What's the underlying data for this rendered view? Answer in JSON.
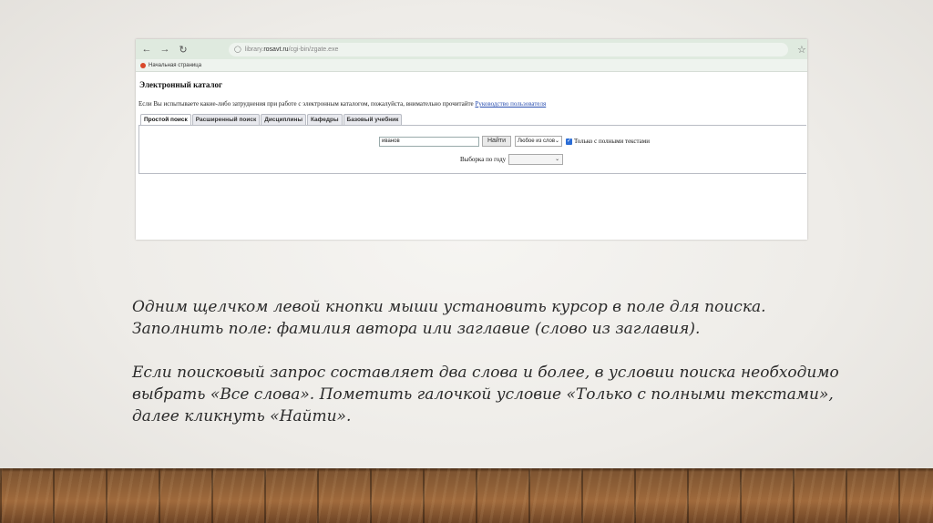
{
  "browser": {
    "back_icon": "arrow-left-icon",
    "forward_icon": "arrow-right-icon",
    "reload_icon": "reload-icon",
    "url_prefix": "library.",
    "url_host": "rosavt.ru",
    "url_path": "/cgi-bin/zgate.exe",
    "bookmark_label": "Начальная страница"
  },
  "catalog": {
    "title": "Электронный каталог",
    "info_text": "Если Вы испытываете какие-либо затруднения при работе с электронным каталогом, пожалуйста, внимательно прочитайте ",
    "info_link": "Руководство пользователя",
    "tabs": [
      {
        "label": "Простой поиск"
      },
      {
        "label": "Расширенный поиск"
      },
      {
        "label": "Дисциплины"
      },
      {
        "label": "Кафедры"
      },
      {
        "label": "Базовый учебник"
      }
    ],
    "search": {
      "value": "иванов",
      "find_label": "Найти",
      "mode_value": "Любое из слов",
      "fulltext_label": "Только с полными текстами",
      "fulltext_checked": true
    },
    "year": {
      "label": "Выборка по году",
      "value": ""
    }
  },
  "caption": {
    "paragraph1": "Одним щелчком левой кнопки мыши установить курсор в поле для поиска. Заполнить поле: фамилия автора или заглавие (слово из заглавия).",
    "paragraph2": "Если поисковый запрос составляет два слова и более, в условии поиска необходимо выбрать «Все слова». Пометить галочкой условие «Только с полными текстами», далее кликнуть «Найти»."
  }
}
